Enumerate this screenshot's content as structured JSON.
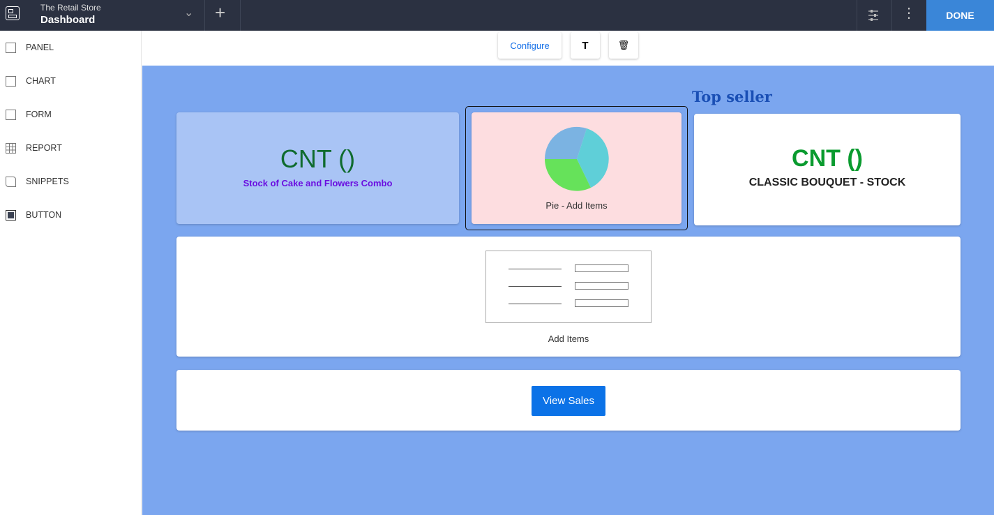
{
  "header": {
    "store": "The Retail Store",
    "title": "Dashboard",
    "done_label": "DONE"
  },
  "sidebar": {
    "items": [
      {
        "label": "PANEL",
        "icon": "panel-icon"
      },
      {
        "label": "CHART",
        "icon": "chart-icon"
      },
      {
        "label": "FORM",
        "icon": "form-icon"
      },
      {
        "label": "REPORT",
        "icon": "report-icon"
      },
      {
        "label": "SNIPPETS",
        "icon": "snippets-icon"
      },
      {
        "label": "BUTTON",
        "icon": "button-icon"
      }
    ]
  },
  "toolbar": {
    "configure": "Configure",
    "text": "T"
  },
  "dashboard": {
    "top_seller": "Top seller",
    "card1": {
      "value": "CNT ()",
      "label": "Stock of Cake and Flowers Combo"
    },
    "card2": {
      "label": "Pie - Add Items"
    },
    "card3": {
      "value": "CNT ()",
      "label": "CLASSIC BOUQUET - STOCK"
    },
    "form_card": {
      "label": "Add Items"
    },
    "button_card": {
      "label": "View Sales"
    }
  },
  "colors": {
    "canvas": "#7ba6ef",
    "accent": "#0b72e7",
    "green": "#0a9b2f",
    "purple": "#6a0ee0"
  }
}
